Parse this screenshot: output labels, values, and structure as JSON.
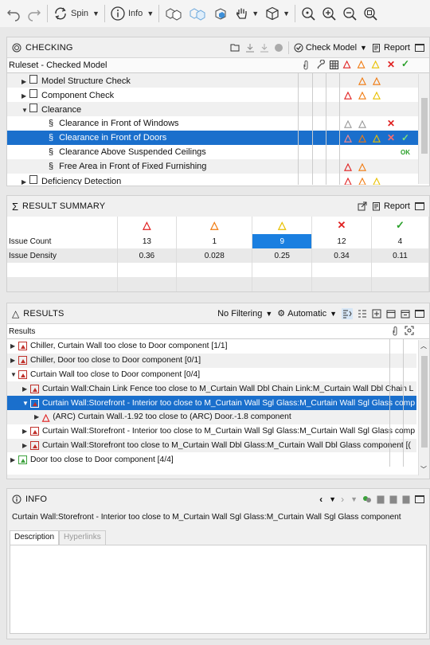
{
  "toolbar": {
    "spin_label": "Spin",
    "info_label": "Info"
  },
  "checking": {
    "title": "CHECKING",
    "check_model_label": "Check Model",
    "report_label": "Report",
    "tree_header": "Ruleset - Checked Model",
    "rows": [
      {
        "label": "Model Structure Check",
        "level": 1,
        "expand": "collapsed",
        "icon": "doc",
        "style": "alt",
        "marks": [
          "",
          "",
          "",
          "orange",
          "orange",
          "",
          "",
          ""
        ]
      },
      {
        "label": "Component Check",
        "level": 1,
        "expand": "collapsed",
        "icon": "doc",
        "style": "white",
        "marks": [
          "",
          "",
          "red",
          "orange",
          "yellow",
          "",
          "",
          ""
        ]
      },
      {
        "label": "Clearance",
        "level": 1,
        "expand": "expanded",
        "icon": "doc",
        "style": "alt",
        "marks": [
          "",
          "",
          "",
          "",
          "",
          "",
          "",
          ""
        ]
      },
      {
        "label": "Clearance in Front of Windows",
        "level": 2,
        "expand": "none",
        "icon": "section",
        "style": "white",
        "marks": [
          "",
          "",
          "grey",
          "grey",
          "",
          "x",
          "",
          ""
        ]
      },
      {
        "label": "Clearance in Front of Doors",
        "level": 2,
        "expand": "none",
        "icon": "section",
        "style": "sel",
        "marks": [
          "",
          "",
          "red",
          "orange",
          "yellow",
          "x",
          "check",
          ""
        ]
      },
      {
        "label": "Clearance Above Suspended Ceilings",
        "level": 2,
        "expand": "none",
        "icon": "section",
        "style": "white",
        "marks": [
          "",
          "",
          "",
          "",
          "",
          "",
          "ok",
          ""
        ]
      },
      {
        "label": "Free Area in Front of Fixed Furnishing",
        "level": 2,
        "expand": "none",
        "icon": "section",
        "style": "alt",
        "marks": [
          "",
          "",
          "red",
          "orange",
          "",
          "",
          "",
          ""
        ]
      },
      {
        "label": "Deficiency Detection",
        "level": 1,
        "expand": "collapsed",
        "icon": "doc",
        "style": "white",
        "marks": [
          "",
          "",
          "red",
          "orange",
          "yellow",
          "",
          "",
          ""
        ]
      }
    ],
    "ok_text": "OK"
  },
  "summary": {
    "title": "RESULT SUMMARY",
    "report_label": "Report",
    "rows": [
      {
        "label": "Issue Count",
        "values": [
          "13",
          "1",
          "9",
          "12",
          "4"
        ]
      },
      {
        "label": "Issue Density",
        "values": [
          "0.36",
          "0.028",
          "0.25",
          "0.34",
          "0.11"
        ]
      }
    ],
    "highlight_index": 2
  },
  "results": {
    "title": "RESULTS",
    "filter_label": "No Filtering",
    "mode_label": "Automatic",
    "tree_header": "Results",
    "rows": [
      {
        "label": "Chiller, Curtain Wall too close to Door component [1/1]",
        "level": 0,
        "expand": "collapsed",
        "icon": "red-x",
        "style": "white"
      },
      {
        "label": "Chiller, Door too close to Door component [0/1]",
        "level": 0,
        "expand": "collapsed",
        "icon": "red",
        "style": "alt"
      },
      {
        "label": "Curtain Wall too close to Door component [0/4]",
        "level": 0,
        "expand": "expanded",
        "icon": "red",
        "style": "white"
      },
      {
        "label": "Curtain Wall:Chain Link Fence too close to M_Curtain Wall Dbl Chain Link:M_Curtain Wall Dbl Chain L",
        "level": 1,
        "expand": "collapsed",
        "icon": "red",
        "style": "alt"
      },
      {
        "label": "Curtain Wall:Storefront - Interior too close to M_Curtain Wall Sgl Glass:M_Curtain Wall Sgl Glass comp",
        "level": 1,
        "expand": "expanded",
        "icon": "red",
        "style": "sel"
      },
      {
        "label": "(ARC) Curtain Wall.-1.92 too close to (ARC) Door.-1.8 component",
        "level": 2,
        "expand": "collapsed",
        "icon": "triangle",
        "style": "alt"
      },
      {
        "label": "Curtain Wall:Storefront - Interior too close to M_Curtain Wall Sgl Glass:M_Curtain Wall Sgl Glass comp",
        "level": 1,
        "expand": "collapsed",
        "icon": "red",
        "style": "white"
      },
      {
        "label": "Curtain Wall:Storefront too close to M_Curtain Wall Dbl Glass:M_Curtain Wall Dbl Glass component [(",
        "level": 1,
        "expand": "collapsed",
        "icon": "red",
        "style": "alt"
      },
      {
        "label": "Door too close to Door component [4/4]",
        "level": 0,
        "expand": "collapsed",
        "icon": "green",
        "style": "white"
      }
    ]
  },
  "info": {
    "title": "INFO",
    "text": "Curtain Wall:Storefront - Interior too close to M_Curtain Wall Sgl Glass:M_Curtain Wall Sgl Glass component",
    "tabs": [
      "Description",
      "Hyperlinks"
    ]
  },
  "colors": {
    "red": "#e02020",
    "orange": "#f07a10",
    "yellow": "#e8c000",
    "green": "#2aa02a",
    "selection": "#1a6fcc",
    "highlight": "#1a7fe0"
  }
}
